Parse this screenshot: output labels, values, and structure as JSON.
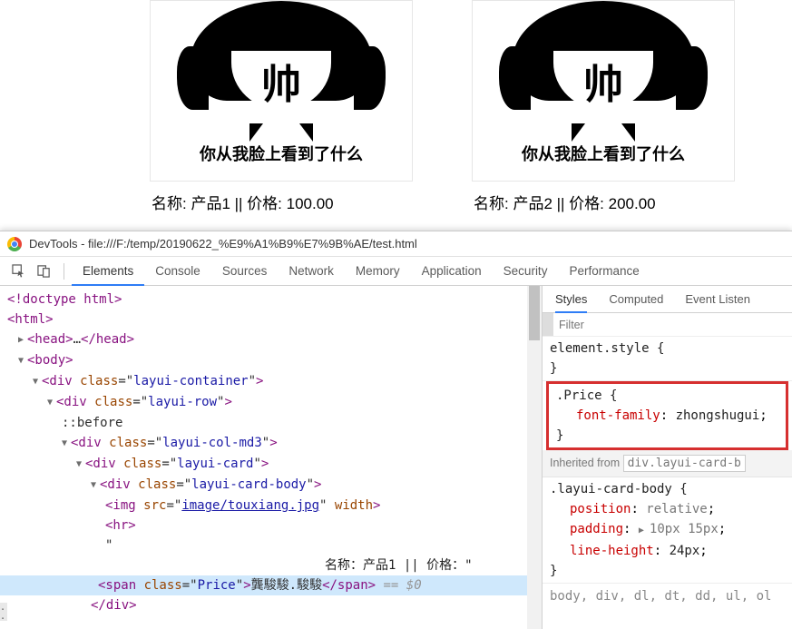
{
  "page": {
    "cards": [
      {
        "face": "帅",
        "caption": "你从我脸上看到了什么",
        "line": "名称:  产品1 || 价格:  100.00"
      },
      {
        "face": "帅",
        "caption": "你从我脸上看到了什么",
        "line": "名称:  产品2 || 价格:  200.00"
      }
    ]
  },
  "devtools": {
    "title": "DevTools - file:///F:/temp/20190622_%E9%A1%B9%E7%9B%AE/test.html",
    "tabs": [
      "Elements",
      "Console",
      "Sources",
      "Network",
      "Memory",
      "Application",
      "Security",
      "Performance"
    ],
    "subtabs": [
      "Styles",
      "Computed",
      "Event Listen"
    ],
    "filter_placeholder": "Filter",
    "elements": {
      "l1": "<!doctype html>",
      "l2_open": "<html>",
      "l3": {
        "open": "<head>",
        "dots": "…",
        "close": "</head>"
      },
      "l4": "<body>",
      "l5_tag": "div",
      "l5_class": "layui-container",
      "l6_tag": "div",
      "l6_class": "layui-row",
      "l7": "::before",
      "l8_tag": "div",
      "l8_class": "layui-col-md3",
      "l9_tag": "div",
      "l9_class": "layui-card",
      "l10_tag": "div",
      "l10_class": "layui-card-body",
      "l11_tag": "img",
      "l11_src": "image/touxiang.jpg",
      "l11_attr2": "width",
      "l12": "<hr>",
      "l13": "\"",
      "l14": "名称：产品1 || 价格：\"",
      "l15_tag": "span",
      "l15_class": "Price",
      "l15_text": "龔駿駿.駿駿",
      "l15_close": "</span>",
      "l15_eq": " == $0",
      "l16": "</div>"
    },
    "styles": {
      "blk1_sel": "element.style {",
      "blk1_close": "}",
      "blk2_sel": ".Price {",
      "blk2_prop": "font-family",
      "blk2_val": "zhongshugui",
      "blk2_close": "}",
      "inherited_label": "Inherited from ",
      "inherited_link": "div.layui-card-b",
      "blk3_sel": ".layui-card-body {",
      "blk3_p1n": "position",
      "blk3_p1v": "relative",
      "blk3_p2n": "padding",
      "blk3_p2v": "10px 15px",
      "blk3_p3n": "line-height",
      "blk3_p3v": "24px",
      "blk3_close": "}",
      "bodyline": "body, div, dl, dt, dd, ul, ol"
    }
  }
}
